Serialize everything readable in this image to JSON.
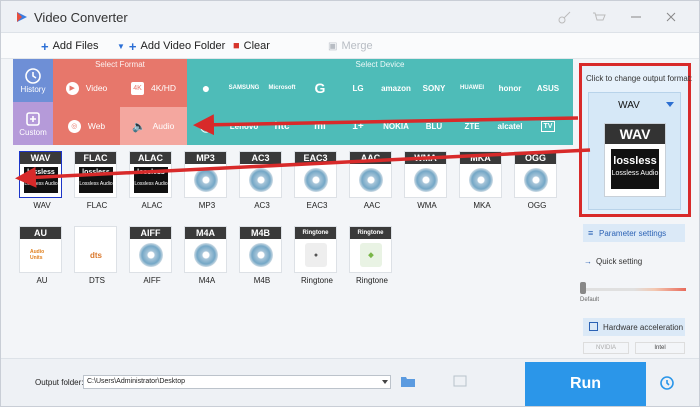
{
  "window": {
    "title": "Video Converter"
  },
  "toolbar": {
    "add_files": "Add Files",
    "add_video_folder": "Add Video Folder",
    "clear": "Clear",
    "merge": "Merge"
  },
  "sidebar": {
    "history": "History",
    "custom": "Custom"
  },
  "format_panel": {
    "label": "Select Format",
    "cells": [
      "Video",
      "4K/HD",
      "Web",
      "Audio"
    ],
    "active": "Audio"
  },
  "device_panel": {
    "label": "Select Device",
    "row1": [
      "",
      "SAMSUNG",
      "Microsoft",
      "G",
      "LG",
      "amazon",
      "SONY",
      "HUAWEI",
      "honor",
      "ASUS"
    ],
    "row2": [
      "",
      "Lenovo",
      "htc",
      "mi",
      "1+",
      "NOKIA",
      "BLU",
      "ZTE",
      "alcatel",
      "TV"
    ]
  },
  "formats": [
    {
      "name": "WAV",
      "hdr": "WAV",
      "kind": "lossless",
      "selected": true
    },
    {
      "name": "FLAC",
      "hdr": "FLAC",
      "kind": "lossless"
    },
    {
      "name": "ALAC",
      "hdr": "ALAC",
      "kind": "lossless"
    },
    {
      "name": "MP3",
      "hdr": "MP3",
      "kind": "disc"
    },
    {
      "name": "AC3",
      "hdr": "AC3",
      "kind": "disc"
    },
    {
      "name": "EAC3",
      "hdr": "EAC3",
      "kind": "disc"
    },
    {
      "name": "AAC",
      "hdr": "AAC",
      "kind": "disc"
    },
    {
      "name": "WMA",
      "hdr": "WMA",
      "kind": "disc"
    },
    {
      "name": "MKA",
      "hdr": "MKA",
      "kind": "disc"
    },
    {
      "name": "OGG",
      "hdr": "OGG",
      "kind": "disc"
    },
    {
      "name": "AU",
      "hdr": "AU",
      "kind": "badge",
      "badge": "Audio Units"
    },
    {
      "name": "DTS",
      "hdr": "",
      "kind": "badge",
      "badge": "dts"
    },
    {
      "name": "AIFF",
      "hdr": "AIFF",
      "kind": "disc"
    },
    {
      "name": "M4A",
      "hdr": "M4A",
      "kind": "disc"
    },
    {
      "name": "M4B",
      "hdr": "M4B",
      "kind": "disc"
    },
    {
      "name": "Ringtone",
      "hdr": "Ringtone",
      "kind": "badge",
      "badge": ""
    },
    {
      "name": "Ringtone",
      "hdr": "Ringtone",
      "kind": "badge",
      "badge": ""
    }
  ],
  "lossless_text": {
    "top": "lossless",
    "bottom": "Lossless Audio"
  },
  "output": {
    "hint": "Click to change output format:",
    "format": "WAV",
    "icon_header": "WAV",
    "icon_top": "lossless",
    "icon_bottom": "Lossless Audio"
  },
  "settings": {
    "parameter": "Parameter settings",
    "quick": "Quick setting",
    "slider_label": "Default",
    "hw": "Hardware acceleration",
    "nvidia": "NVIDIA",
    "intel": "Intel"
  },
  "bottom": {
    "output_folder_label": "Output folder:",
    "output_folder_value": "C:\\Users\\Administrator\\Desktop",
    "run": "Run"
  },
  "colors": {
    "format_block": "#e7776b",
    "device_block": "#4ebcb8",
    "accent": "#2b96e9",
    "annotation_red": "#d82a2a"
  }
}
